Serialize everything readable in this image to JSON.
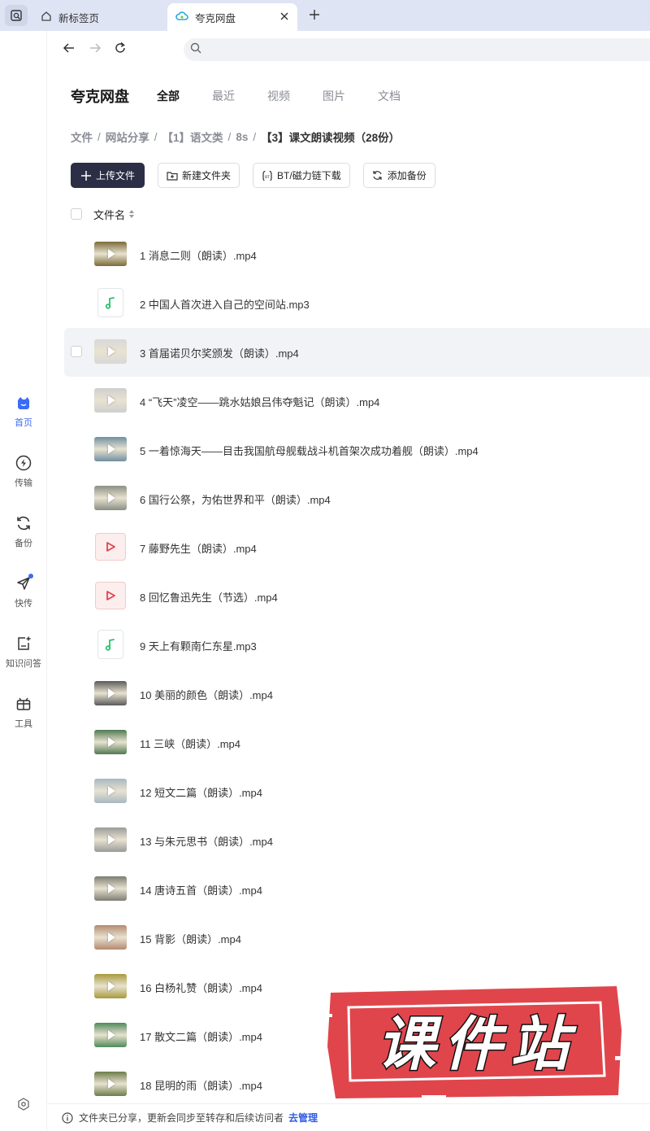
{
  "browser": {
    "tabs": [
      {
        "title": "新标签页",
        "icon": "home-icon",
        "active": false
      },
      {
        "title": "夸克网盘",
        "icon": "cloud-icon",
        "active": true
      }
    ],
    "new_tab_icon": "plus-icon",
    "address_placeholder": ""
  },
  "sidebar": {
    "items": [
      {
        "label": "首页",
        "icon": "home-face-icon",
        "active": true
      },
      {
        "label": "传输",
        "icon": "transfer-icon",
        "active": false
      },
      {
        "label": "备份",
        "icon": "backup-icon",
        "active": false
      },
      {
        "label": "快传",
        "icon": "send-icon",
        "active": false,
        "dot": true
      },
      {
        "label": "知识问答",
        "icon": "qa-icon",
        "active": false
      },
      {
        "label": "工具",
        "icon": "toolbox-icon",
        "active": false
      }
    ],
    "settings_icon": "settings-icon"
  },
  "header": {
    "app_title": "夸克网盘",
    "categories": [
      "全部",
      "最近",
      "视频",
      "图片",
      "文档"
    ],
    "active_category": "全部"
  },
  "breadcrumb": [
    "文件",
    "网站分享",
    "【1】语文类",
    "8s",
    "【3】课文朗读视频（28份）"
  ],
  "toolbar": {
    "upload": "上传文件",
    "new_folder": "新建文件夹",
    "bt_download": "BT/磁力链下载",
    "add_backup": "添加备份"
  },
  "list": {
    "column_name": "文件名",
    "files": [
      {
        "name": "1 消息二则（朗读）.mp4",
        "type": "video",
        "thumb": "#7c6a3a"
      },
      {
        "name": "2 中国人首次进入自己的空间站.mp3",
        "type": "audio"
      },
      {
        "name": "3 首届诺贝尔奖颁发（朗读）.mp4",
        "type": "video",
        "thumb": "#d8d8d8"
      },
      {
        "name": "4 “飞天”凌空——跳水姑娘吕伟夺魁记（朗读）.mp4",
        "type": "video",
        "thumb": "#cfcfcf"
      },
      {
        "name": "5 一着惊海天——目击我国航母舰载战斗机首架次成功着舰（朗读）.mp4",
        "type": "video",
        "thumb": "#6f8fa0"
      },
      {
        "name": "6 国行公祭，为佑世界和平（朗读）.mp4",
        "type": "video",
        "thumb": "#8b8f84"
      },
      {
        "name": "7 藤野先生（朗读）.mp4",
        "type": "videofile"
      },
      {
        "name": "8 回忆鲁迅先生（节选）.mp4",
        "type": "videofile"
      },
      {
        "name": "9 天上有颗南仁东星.mp3",
        "type": "audio"
      },
      {
        "name": "10 美丽的颜色（朗读）.mp4",
        "type": "video",
        "thumb": "#5a5a5a"
      },
      {
        "name": "11 三峡（朗读）.mp4",
        "type": "video",
        "thumb": "#4f7a52"
      },
      {
        "name": "12 短文二篇（朗读）.mp4",
        "type": "video",
        "thumb": "#a7b8c2"
      },
      {
        "name": "13 与朱元思书（朗读）.mp4",
        "type": "video",
        "thumb": "#9a9a9a"
      },
      {
        "name": "14 唐诗五首（朗读）.mp4",
        "type": "video",
        "thumb": "#7d7d72"
      },
      {
        "name": "15 背影（朗读）.mp4",
        "type": "video",
        "thumb": "#b48a70"
      },
      {
        "name": "16 白杨礼赞（朗读）.mp4",
        "type": "video",
        "thumb": "#a89a3c"
      },
      {
        "name": "17 散文二篇（朗读）.mp4",
        "type": "video",
        "thumb": "#4f8a5a"
      },
      {
        "name": "18 昆明的雨（朗读）.mp4",
        "type": "video",
        "thumb": "#6c7d4a"
      }
    ],
    "hover_row": 3
  },
  "footer": {
    "message": "文件夹已分享，更新会同步至转存和后续访问者",
    "link": "去管理"
  },
  "watermark": {
    "text": "课件站",
    "color": "#e0454c"
  }
}
